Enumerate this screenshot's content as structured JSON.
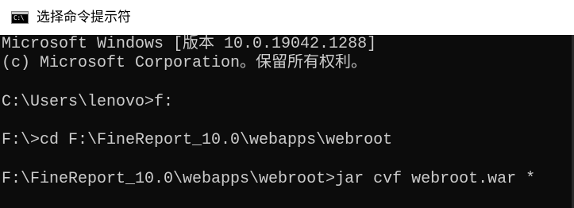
{
  "window": {
    "title": "选择命令提示符",
    "icon": "cmd-console-icon",
    "icon_glyph": "C:\\",
    "accent_color": "#ffffff"
  },
  "console": {
    "text_color": "#cccccc",
    "background_color": "#0c0c0c",
    "lines": [
      "Microsoft Windows [版本 10.0.19042.1288]",
      "(c) Microsoft Corporation。保留所有权利。",
      "",
      "C:\\Users\\lenovo>f:",
      "",
      "F:\\>cd F:\\FineReport_10.0\\webapps\\webroot",
      "",
      "F:\\FineReport_10.0\\webapps\\webroot>jar cvf webroot.war *"
    ]
  }
}
